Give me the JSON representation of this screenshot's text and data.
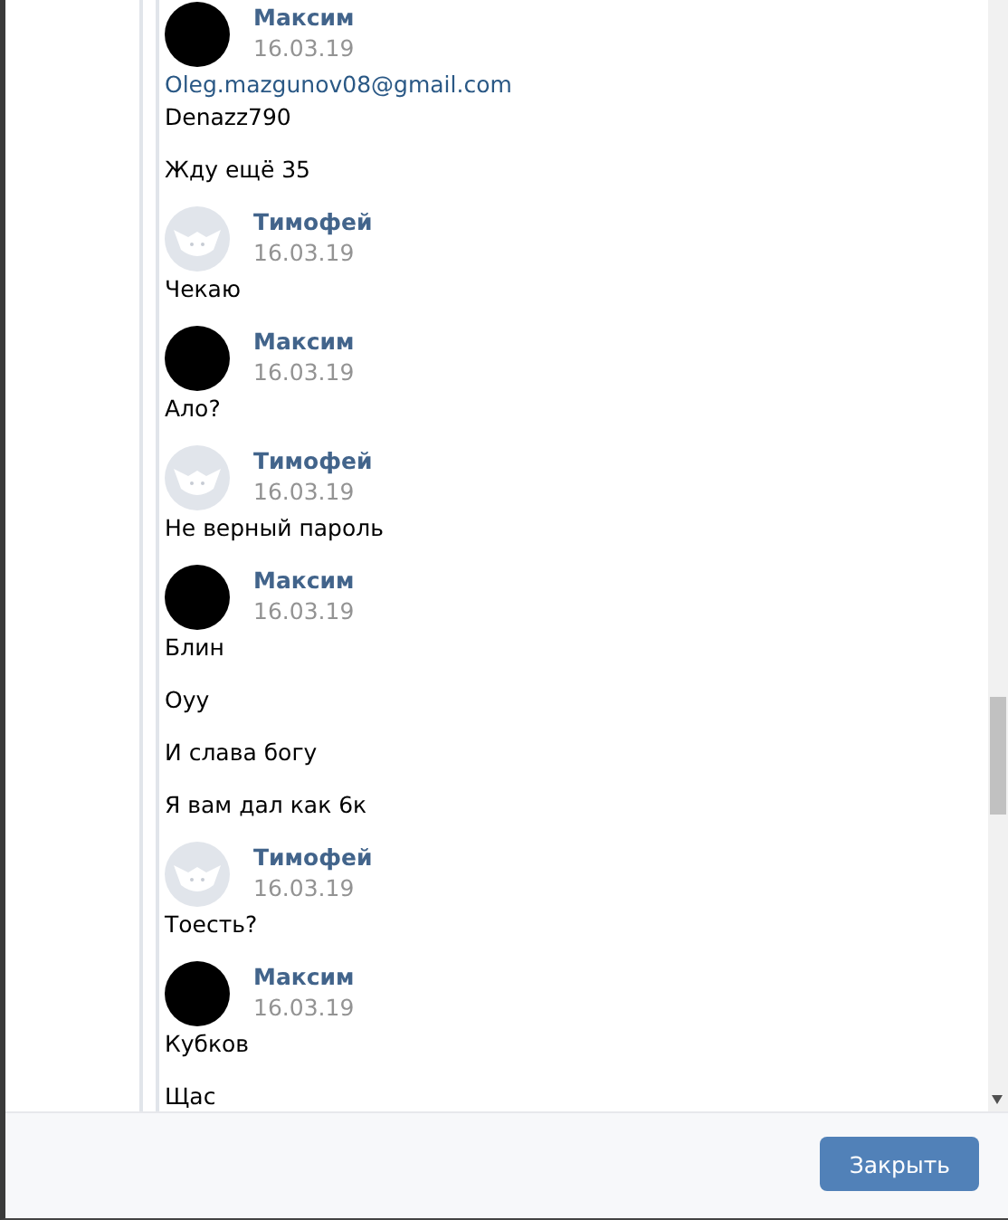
{
  "posts": [
    {
      "author": "Максим",
      "date": "16.03.19",
      "kind": "dark",
      "messages": [
        [
          {
            "kind": "link",
            "text": "Oleg.mazgunov08@gmail.com"
          },
          {
            "kind": "text",
            "text": "Denazz790"
          }
        ],
        [
          {
            "kind": "text",
            "text": "Жду ещё 35"
          }
        ]
      ]
    },
    {
      "author": "Тимофей",
      "date": "16.03.19",
      "kind": "default",
      "messages": [
        [
          {
            "kind": "text",
            "text": "Чекаю"
          }
        ]
      ]
    },
    {
      "author": "Максим",
      "date": "16.03.19",
      "kind": "dark",
      "messages": [
        [
          {
            "kind": "text",
            "text": "Ало?"
          }
        ]
      ]
    },
    {
      "author": "Тимофей",
      "date": "16.03.19",
      "kind": "default",
      "messages": [
        [
          {
            "kind": "text",
            "text": "Не верный пароль"
          }
        ]
      ]
    },
    {
      "author": "Максим",
      "date": "16.03.19",
      "kind": "dark",
      "messages": [
        [
          {
            "kind": "text",
            "text": "Блин"
          }
        ],
        [
          {
            "kind": "text",
            "text": "Оуу"
          }
        ],
        [
          {
            "kind": "text",
            "text": "И слава богу"
          }
        ],
        [
          {
            "kind": "text",
            "text": "Я вам дал как 6к"
          }
        ]
      ]
    },
    {
      "author": "Тимофей",
      "date": "16.03.19",
      "kind": "default",
      "messages": [
        [
          {
            "kind": "text",
            "text": "Тоесть?"
          }
        ]
      ]
    },
    {
      "author": "Максим",
      "date": "16.03.19",
      "kind": "dark",
      "messages": [
        [
          {
            "kind": "text",
            "text": "Кубков"
          }
        ],
        [
          {
            "kind": "text",
            "text": "Щас"
          }
        ]
      ]
    }
  ],
  "footer": {
    "button": "Закрыть"
  }
}
